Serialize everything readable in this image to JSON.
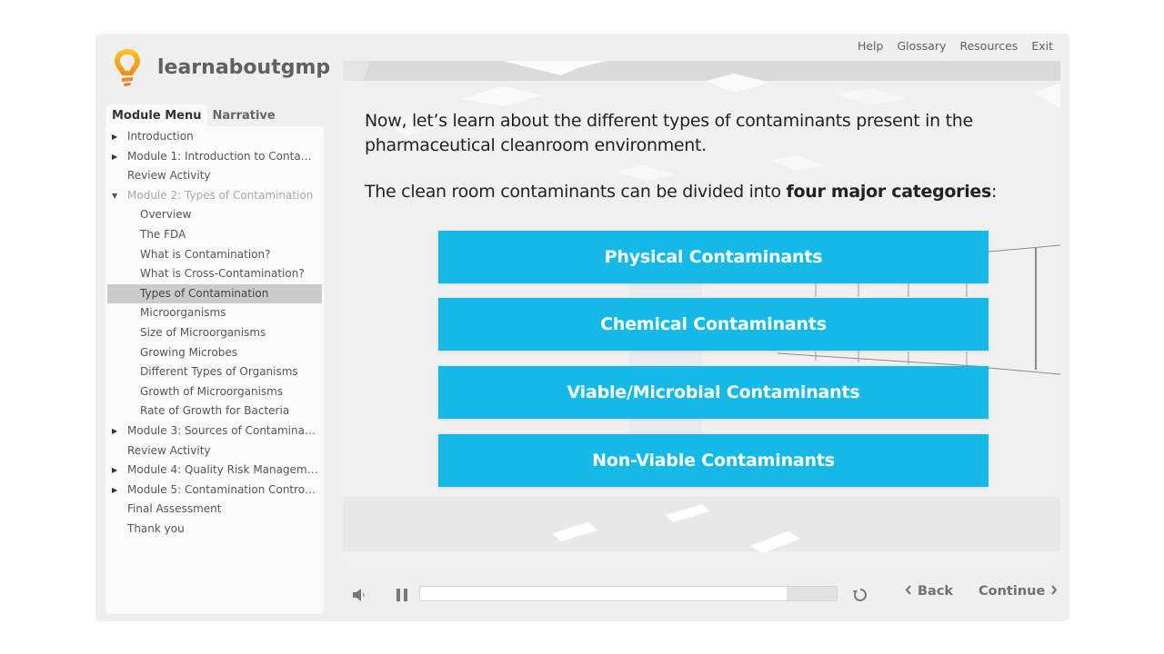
{
  "brand": {
    "name": "learnaboutgmp",
    "logo_icon": "lightbulb-icon"
  },
  "top_links": [
    "Help",
    "Glossary",
    "Resources",
    "Exit"
  ],
  "sidebar": {
    "tabs": [
      {
        "label": "Module Menu",
        "active": true
      },
      {
        "label": "Narrative",
        "active": false
      }
    ],
    "items": [
      {
        "label": "Introduction",
        "level": 0,
        "arrow": "collapsed"
      },
      {
        "label": "Module 1: Introduction to Contam...",
        "level": 0,
        "arrow": "collapsed"
      },
      {
        "label": "Review Activity",
        "level": 0,
        "arrow": "none"
      },
      {
        "label": "Module 2: Types of Contamination",
        "level": 0,
        "arrow": "expanded",
        "dim": true
      },
      {
        "label": "Overview",
        "level": 1
      },
      {
        "label": "The FDA",
        "level": 1
      },
      {
        "label": "What is Contamination?",
        "level": 1
      },
      {
        "label": "What is Cross-Contamination?",
        "level": 1
      },
      {
        "label": "Types of Contamination",
        "level": 1,
        "selected": true
      },
      {
        "label": "Microorganisms",
        "level": 1
      },
      {
        "label": "Size of Microorganisms",
        "level": 1
      },
      {
        "label": "Growing Microbes",
        "level": 1
      },
      {
        "label": "Different Types of Organisms",
        "level": 1
      },
      {
        "label": "Growth of Microorganisms",
        "level": 1
      },
      {
        "label": "Rate of Growth for Bacteria",
        "level": 1
      },
      {
        "label": "Module 3: Sources of Contaminati...",
        "level": 0,
        "arrow": "collapsed"
      },
      {
        "label": "Review Activity",
        "level": 0,
        "arrow": "none"
      },
      {
        "label": "Module 4: Quality Risk Management",
        "level": 0,
        "arrow": "collapsed"
      },
      {
        "label": "Module 5: Contamination Control ...",
        "level": 0,
        "arrow": "collapsed"
      },
      {
        "label": "Final Assessment",
        "level": 0,
        "arrow": "none"
      },
      {
        "label": "Thank you",
        "level": 0,
        "arrow": "none"
      }
    ]
  },
  "slide": {
    "intro": "Now, let’s learn about the different types of contaminants present in the pharmaceutical cleanroom environment.",
    "sub_prefix": "The clean room contaminants can be divided into ",
    "sub_bold": "four major categories",
    "sub_suffix": ":",
    "categories": [
      "Physical Contaminants",
      "Chemical Contaminants",
      "Viable/Microbial Contaminants",
      "Non-Viable Contaminants"
    ],
    "accent_color": "#15b9e8"
  },
  "controls": {
    "volume_icon": "speaker-icon",
    "play_state": "playing",
    "progress_percent": 88,
    "replay_icon": "replay-icon",
    "back_label": "Back",
    "continue_label": "Continue"
  }
}
